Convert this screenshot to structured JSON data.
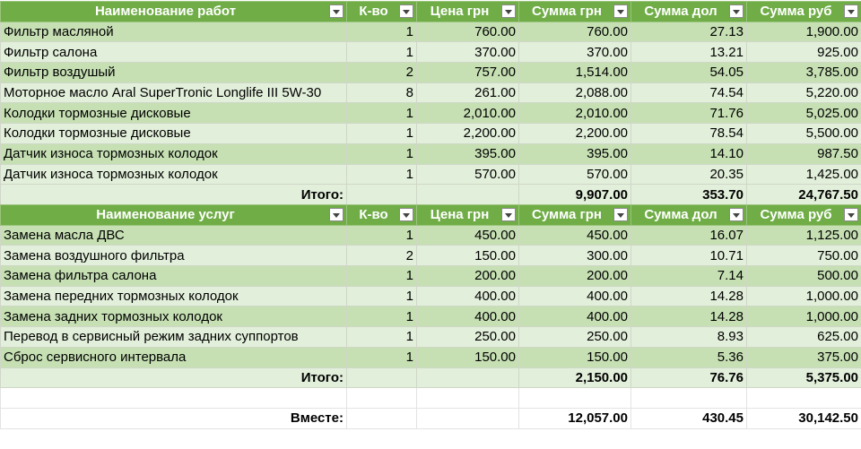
{
  "works": {
    "headers": [
      "Наименование работ",
      "К-во",
      "Цена грн",
      "Сумма грн",
      "Сумма дол",
      "Сумма руб"
    ],
    "rows": [
      [
        "Фильтр масляной",
        "1",
        "760.00",
        "760.00",
        "27.13",
        "1,900.00"
      ],
      [
        "Фильтр салона",
        "1",
        "370.00",
        "370.00",
        "13.21",
        "925.00"
      ],
      [
        "Фильтр воздушый",
        "2",
        "757.00",
        "1,514.00",
        "54.05",
        "3,785.00"
      ],
      [
        "Моторное масло Aral SuperTronic Longlife III 5W-30",
        "8",
        "261.00",
        "2,088.00",
        "74.54",
        "5,220.00"
      ],
      [
        "Колодки тормозные дисковые",
        "1",
        "2,010.00",
        "2,010.00",
        "71.76",
        "5,025.00"
      ],
      [
        "Колодки тормозные дисковые",
        "1",
        "2,200.00",
        "2,200.00",
        "78.54",
        "5,500.00"
      ],
      [
        "Датчик износа тормозных колодок",
        "1",
        "395.00",
        "395.00",
        "14.10",
        "987.50"
      ],
      [
        "Датчик износа тормозных колодок",
        "1",
        "570.00",
        "570.00",
        "20.35",
        "1,425.00"
      ]
    ],
    "total_label": "Итого:",
    "total_uah": "9,907.00",
    "total_usd": "353.70",
    "total_rub": "24,767.50"
  },
  "services": {
    "headers": [
      "Наименование услуг",
      "К-во",
      "Цена грн",
      "Сумма грн",
      "Сумма дол",
      "Сумма руб"
    ],
    "rows": [
      [
        "Замена масла ДВС",
        "1",
        "450.00",
        "450.00",
        "16.07",
        "1,125.00"
      ],
      [
        "Замена воздушного фильтра",
        "2",
        "150.00",
        "300.00",
        "10.71",
        "750.00"
      ],
      [
        "Замена фильтра салона",
        "1",
        "200.00",
        "200.00",
        "7.14",
        "500.00"
      ],
      [
        "Замена передних тормозных колодок",
        "1",
        "400.00",
        "400.00",
        "14.28",
        "1,000.00"
      ],
      [
        "Замена задних тормозных колодок",
        "1",
        "400.00",
        "400.00",
        "14.28",
        "1,000.00"
      ],
      [
        "Перевод в сервисный режим задних суппортов",
        "1",
        "250.00",
        "250.00",
        "8.93",
        "625.00"
      ],
      [
        "Сброс сервисного интервала",
        "1",
        "150.00",
        "150.00",
        "5.36",
        "375.00"
      ]
    ],
    "total_label": "Итого:",
    "total_uah": "2,150.00",
    "total_usd": "76.76",
    "total_rub": "5,375.00"
  },
  "grand_total": {
    "label": "Вместе:",
    "uah": "12,057.00",
    "usd": "430.45",
    "rub": "30,142.50"
  }
}
